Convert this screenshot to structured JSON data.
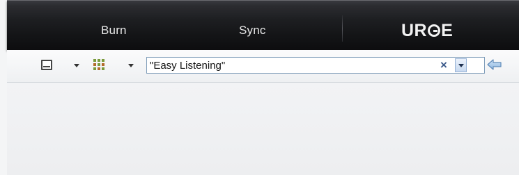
{
  "nav": {
    "tabs": [
      {
        "label": "Burn"
      },
      {
        "label": "Sync"
      }
    ],
    "logo_text": "URGE"
  },
  "toolbar": {
    "layout_icon": "layout-options-icon",
    "grid_icon": "view-options-icon",
    "search": {
      "value": "\"Easy Listening\"",
      "clear_icon": "clear-icon",
      "dropdown_icon": "chevron-down-icon"
    },
    "back_icon": "back-arrow-icon"
  },
  "colors": {
    "nav_background": "#141517",
    "nav_text": "#e8e8e8",
    "toolbar_background": "#f4f5f6",
    "search_border": "#7f9db9",
    "accent_blue": "#3c5a8a",
    "grid_icon_green": "#7a9a3a"
  }
}
